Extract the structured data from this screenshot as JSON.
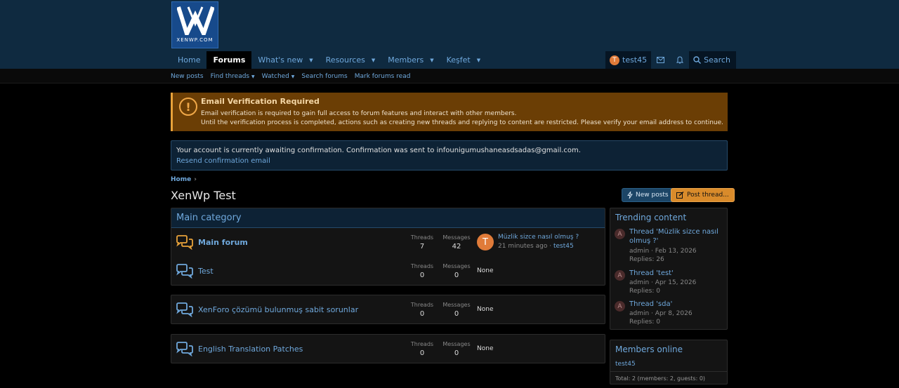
{
  "logo": {
    "text": "XENWP.COM"
  },
  "nav": {
    "items": [
      {
        "label": "Home",
        "active": false,
        "caret": false
      },
      {
        "label": "Forums",
        "active": true,
        "caret": false
      },
      {
        "label": "What's new",
        "active": false,
        "caret": true
      },
      {
        "label": "Resources",
        "active": false,
        "caret": true
      },
      {
        "label": "Members",
        "active": false,
        "caret": true
      },
      {
        "label": "Keşfet",
        "active": false,
        "caret": true
      }
    ],
    "user": {
      "name": "test45",
      "initial": "T"
    },
    "search_label": "Search"
  },
  "subnav": {
    "items": [
      "New posts",
      "Find threads",
      "Watched",
      "Search forums",
      "Mark forums read"
    ]
  },
  "notice_warning": {
    "title": "Email Verification Required",
    "line1": "Email verification is required to gain full access to forum features and interact with other members.",
    "line2": "Until the verification process is completed, actions such as creating new threads and replying to content are restricted. Please verify your email address to continue."
  },
  "notice_info": {
    "message": "Your account is currently awaiting confirmation. Confirmation was sent to infounigumushaneasdsadas@gmail.com.",
    "link": "Resend confirmation email"
  },
  "breadcrumb": {
    "home": "Home"
  },
  "page": {
    "title": "XenWp Test",
    "new_posts_label": "New posts",
    "post_thread_label": "Post thread..."
  },
  "labels": {
    "threads": "Threads",
    "messages": "Messages",
    "none": "None"
  },
  "category": {
    "title": "Main category",
    "nodes": [
      {
        "name": "Main forum",
        "threads": "7",
        "messages": "42",
        "last_title": "Müzlik sizce nasıl olmuş ?",
        "last_time": "21 minutes ago",
        "last_user": "test45",
        "last_initial": "T"
      },
      {
        "name": "Test",
        "threads": "0",
        "messages": "0"
      }
    ]
  },
  "standalone_nodes": [
    {
      "name": "XenForo çözümü bulunmuş sabit sorunlar",
      "threads": "0",
      "messages": "0"
    },
    {
      "name": "English Translation Patches",
      "threads": "0",
      "messages": "0"
    }
  ],
  "trending": {
    "title": "Trending content",
    "items": [
      {
        "initial": "A",
        "title": "Thread 'Müzlik sizce nasıl olmuş ?'",
        "meta": "admin · Feb 13, 2026",
        "replies": "Replies: 26"
      },
      {
        "initial": "A",
        "title": "Thread 'test'",
        "meta": "admin · Apr 15, 2026",
        "replies": "Replies: 0"
      },
      {
        "initial": "A",
        "title": "Thread 'sda'",
        "meta": "admin · Apr 8, 2026",
        "replies": "Replies: 0"
      }
    ]
  },
  "members_online": {
    "title": "Members online",
    "member": "test45",
    "total": "Total: 2 (members: 2, guests: 0)"
  },
  "colors": {
    "accent": "#6fa8dc",
    "header_bg": "#0f2a40",
    "warning_bg": "#6b3e05",
    "button_orange": "#d98b2b"
  }
}
